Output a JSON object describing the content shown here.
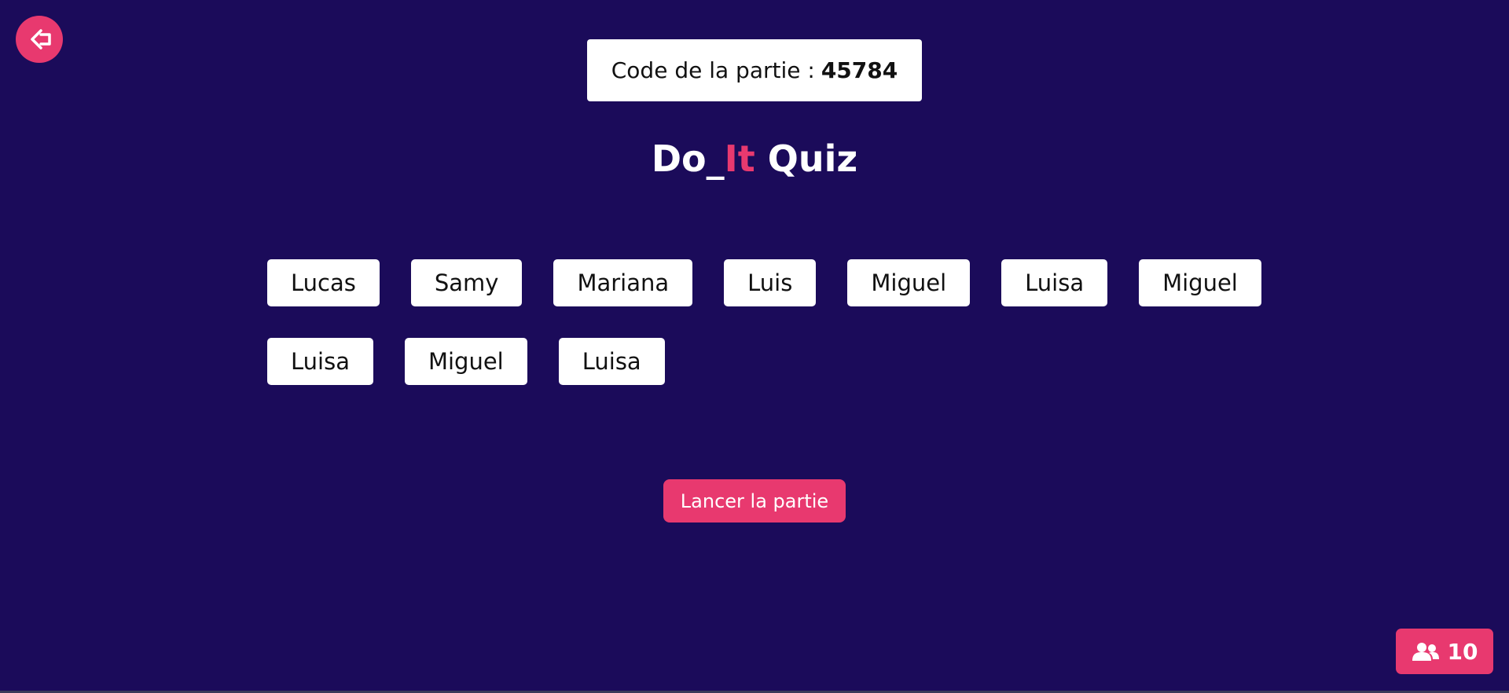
{
  "header": {
    "code_label": "Code de la partie :",
    "code_value": "45784"
  },
  "logo": {
    "part1": "Do_",
    "part2": "It",
    "part3": " Quiz",
    "accent_color": "#e8396f"
  },
  "players": [
    "Lucas",
    "Samy",
    "Mariana",
    "Luis",
    "Miguel",
    "Luisa",
    "Miguel",
    "Luisa",
    "Miguel",
    "Luisa"
  ],
  "start_button": {
    "label": "Lancer la partie"
  },
  "player_count": {
    "value": "10",
    "icon": "users-icon"
  },
  "back_button": {
    "icon": "arrow-left-icon"
  },
  "colors": {
    "background": "#1b0b5a",
    "accent": "#e8396f",
    "card": "#ffffff"
  }
}
